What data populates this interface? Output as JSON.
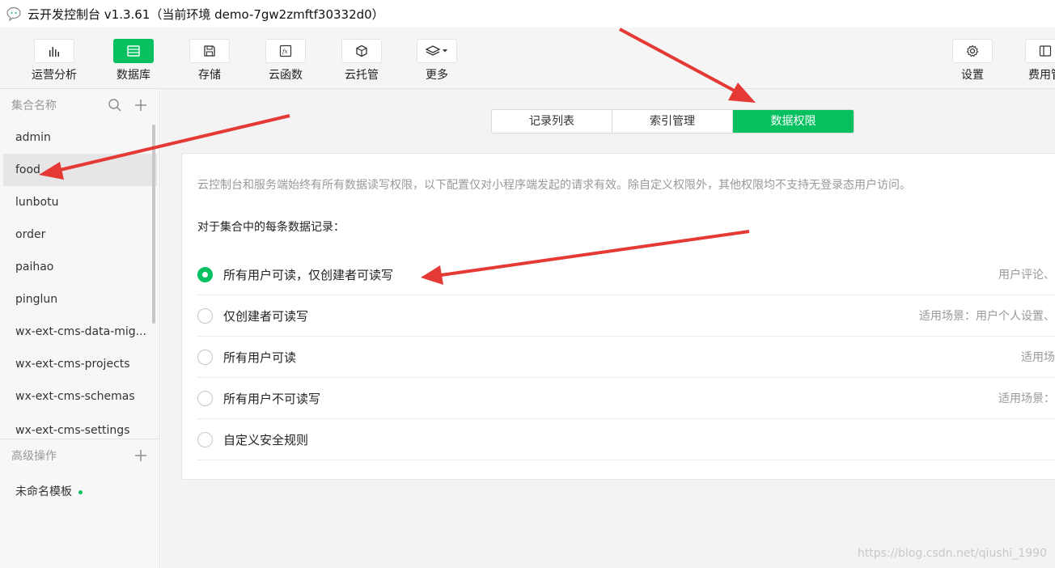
{
  "window": {
    "title": "云开发控制台 v1.3.61（当前环境 demo-7gw2zmftf30332d0）"
  },
  "toolbar": {
    "items": [
      {
        "label": "运营分析",
        "icon": "bar-chart-icon"
      },
      {
        "label": "数据库",
        "icon": "database-icon",
        "active": true
      },
      {
        "label": "存储",
        "icon": "storage-icon"
      },
      {
        "label": "云函数",
        "icon": "function-icon"
      },
      {
        "label": "云托管",
        "icon": "cube-icon"
      },
      {
        "label": "更多",
        "icon": "layers-icon"
      },
      {
        "label": "设置",
        "icon": "gear-icon"
      },
      {
        "label": "费用管",
        "icon": "billing-icon"
      }
    ]
  },
  "sidebar": {
    "collections_header": "集合名称",
    "collections": [
      {
        "name": "admin"
      },
      {
        "name": "food",
        "selected": true
      },
      {
        "name": "lunbotu"
      },
      {
        "name": "order"
      },
      {
        "name": "paihao"
      },
      {
        "name": "pinglun"
      },
      {
        "name": "wx-ext-cms-data-mig..."
      },
      {
        "name": "wx-ext-cms-projects"
      },
      {
        "name": "wx-ext-cms-schemas"
      },
      {
        "name": "wx-ext-cms-settings"
      }
    ],
    "advanced_header": "高级操作",
    "templates": [
      {
        "name": "未命名模板"
      }
    ]
  },
  "tabs": [
    {
      "label": "记录列表"
    },
    {
      "label": "索引管理"
    },
    {
      "label": "数据权限",
      "active": true
    }
  ],
  "permissions": {
    "notice": "云控制台和服务端始终有所有数据读写权限，以下配置仅对小程序端发起的请求有效。除自定义权限外，其他权限均不支持无登录态用户访问。",
    "subtitle": "对于集合中的每条数据记录：",
    "options": [
      {
        "label": "所有用户可读，仅创建者可读写",
        "hint": "用户评论、",
        "checked": true
      },
      {
        "label": "仅创建者可读写",
        "hint": "适用场景：用户个人设置、"
      },
      {
        "label": "所有用户可读",
        "hint": "适用场"
      },
      {
        "label": "所有用户不可读写",
        "hint": "适用场景："
      },
      {
        "label": "自定义安全规则",
        "hint": ""
      }
    ]
  },
  "watermark": "https://blog.csdn.net/qiushi_1990",
  "colors": {
    "accent": "#07c160",
    "arrow": "#e53935"
  }
}
